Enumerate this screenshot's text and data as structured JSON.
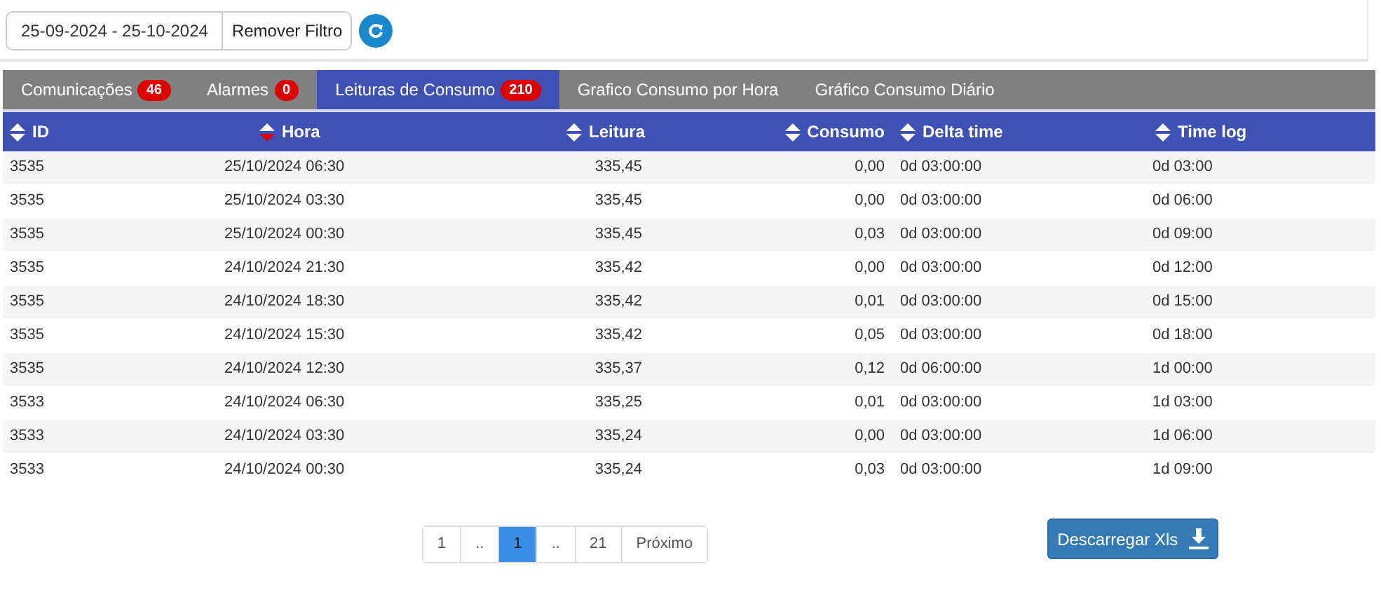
{
  "filter": {
    "date_range": "25-09-2024 - 25-10-2024",
    "remove_button": "Remover Filtro"
  },
  "tabs": [
    {
      "label": "Comunicações",
      "badge": "46",
      "selected": false
    },
    {
      "label": "Alarmes",
      "badge": "0",
      "selected": false
    },
    {
      "label": "Leituras de Consumo",
      "badge": "210",
      "selected": true
    },
    {
      "label": "Grafico Consumo por Hora",
      "selected": false
    },
    {
      "label": "Gráfico Consumo Diário",
      "selected": false
    }
  ],
  "table": {
    "columns": [
      {
        "label": "ID",
        "sorted_descending": false
      },
      {
        "label": "Hora",
        "sorted_descending": true
      },
      {
        "label": "Leitura",
        "sorted_descending": false
      },
      {
        "label": "Consumo",
        "sorted_descending": false
      },
      {
        "label": "Delta time",
        "sorted_descending": false
      },
      {
        "label": "Time log",
        "sorted_descending": false
      }
    ],
    "rows": [
      [
        "3535",
        "25/10/2024 06:30",
        "335,45",
        "0,00",
        "0d 03:00:00",
        "0d 03:00"
      ],
      [
        "3535",
        "25/10/2024 03:30",
        "335,45",
        "0,00",
        "0d 03:00:00",
        "0d 06:00"
      ],
      [
        "3535",
        "25/10/2024 00:30",
        "335,45",
        "0,03",
        "0d 03:00:00",
        "0d 09:00"
      ],
      [
        "3535",
        "24/10/2024 21:30",
        "335,42",
        "0,00",
        "0d 03:00:00",
        "0d 12:00"
      ],
      [
        "3535",
        "24/10/2024 18:30",
        "335,42",
        "0,01",
        "0d 03:00:00",
        "0d 15:00"
      ],
      [
        "3535",
        "24/10/2024 15:30",
        "335,42",
        "0,05",
        "0d 03:00:00",
        "0d 18:00"
      ],
      [
        "3535",
        "24/10/2024 12:30",
        "335,37",
        "0,12",
        "0d 06:00:00",
        "1d 00:00"
      ],
      [
        "3533",
        "24/10/2024 06:30",
        "335,25",
        "0,01",
        "0d 03:00:00",
        "1d 03:00"
      ],
      [
        "3533",
        "24/10/2024 03:30",
        "335,24",
        "0,00",
        "0d 03:00:00",
        "1d 06:00"
      ],
      [
        "3533",
        "24/10/2024 00:30",
        "335,24",
        "0,03",
        "0d 03:00:00",
        "1d 09:00"
      ]
    ]
  },
  "pagination": [
    {
      "label": "1",
      "selected": false
    },
    {
      "label": "..",
      "selected": false
    },
    {
      "label": "1",
      "selected": true
    },
    {
      "label": "..",
      "selected": false
    },
    {
      "label": "21",
      "selected": false
    },
    {
      "label": "Próximo",
      "selected": false
    }
  ],
  "download_button": "Descarregar Xls"
}
